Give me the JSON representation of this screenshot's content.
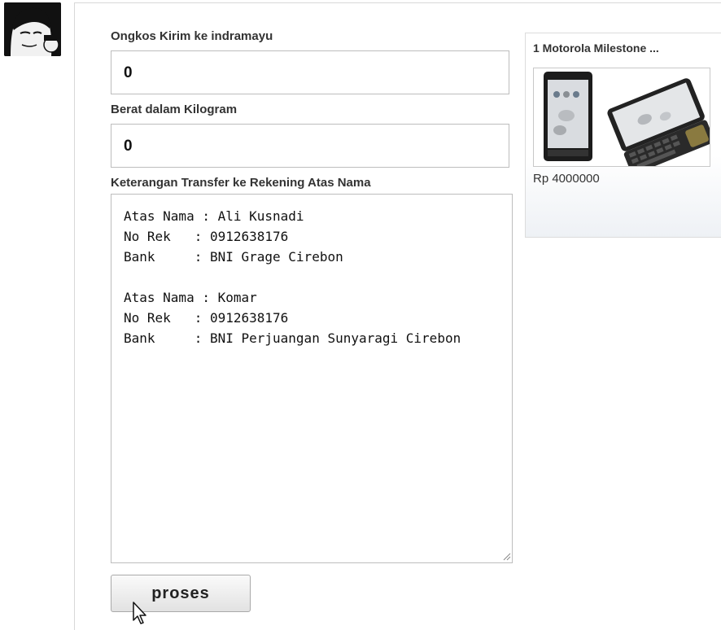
{
  "user": {
    "avatar_icon": "user-avatar-icon"
  },
  "form": {
    "shipping_label": "Ongkos Kirim ke indramayu",
    "shipping_value": "0",
    "weight_label": "Berat dalam Kilogram",
    "weight_value": "0",
    "transfer_label": "Keterangan Transfer ke Rekening Atas Nama",
    "transfer_text": "Atas Nama : Ali Kusnadi\nNo Rek   : 0912638176\nBank     : BNI Grage Cirebon\n\nAtas Nama : Komar\nNo Rek   : 0912638176\nBank     : BNI Perjuangan Sunyaragi Cirebon",
    "submit_label": "proses"
  },
  "cart": {
    "item_title": "1 Motorola Milestone ...",
    "item_price": "Rp 4000000"
  }
}
